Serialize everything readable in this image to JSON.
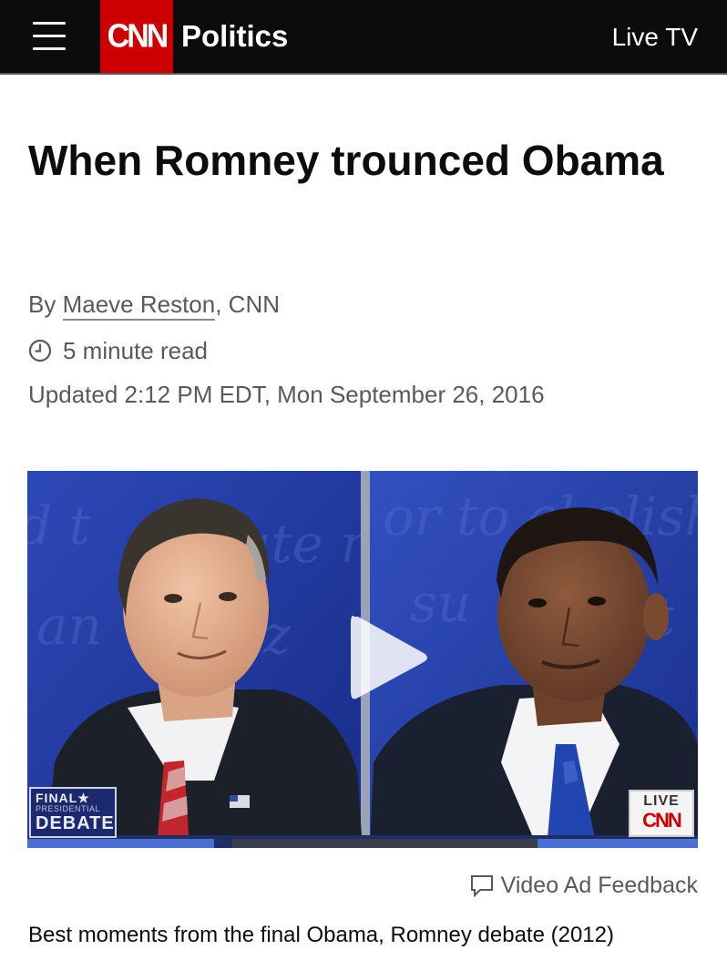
{
  "header": {
    "logo_text": "CNN",
    "section": "Politics",
    "live_tv": "Live TV",
    "brand_color": "#cc0000",
    "background": "#0c0c0c"
  },
  "article": {
    "headline": "When Romney trounced Obama",
    "byline_prefix": "By ",
    "author": "Maeve Reston",
    "byline_suffix": ", CNN",
    "read_time": "5 minute read",
    "updated": "Updated 2:12 PM EDT, Mon September 26, 2016"
  },
  "video": {
    "final_debate_badge_top": "FINAL★",
    "final_debate_badge_mid": "PRESIDENTIAL",
    "final_debate_badge_bottom": "DEBATE",
    "live_badge": "LIVE",
    "live_badge_logo": "CNN",
    "feedback_label": "Video Ad Feedback",
    "caption": "Best moments from the final Obama, Romney debate (2012)"
  },
  "icons": {
    "menu": "hamburger-menu-icon",
    "clock": "clock-icon",
    "play": "play-icon",
    "feedback": "feedback-icon"
  }
}
